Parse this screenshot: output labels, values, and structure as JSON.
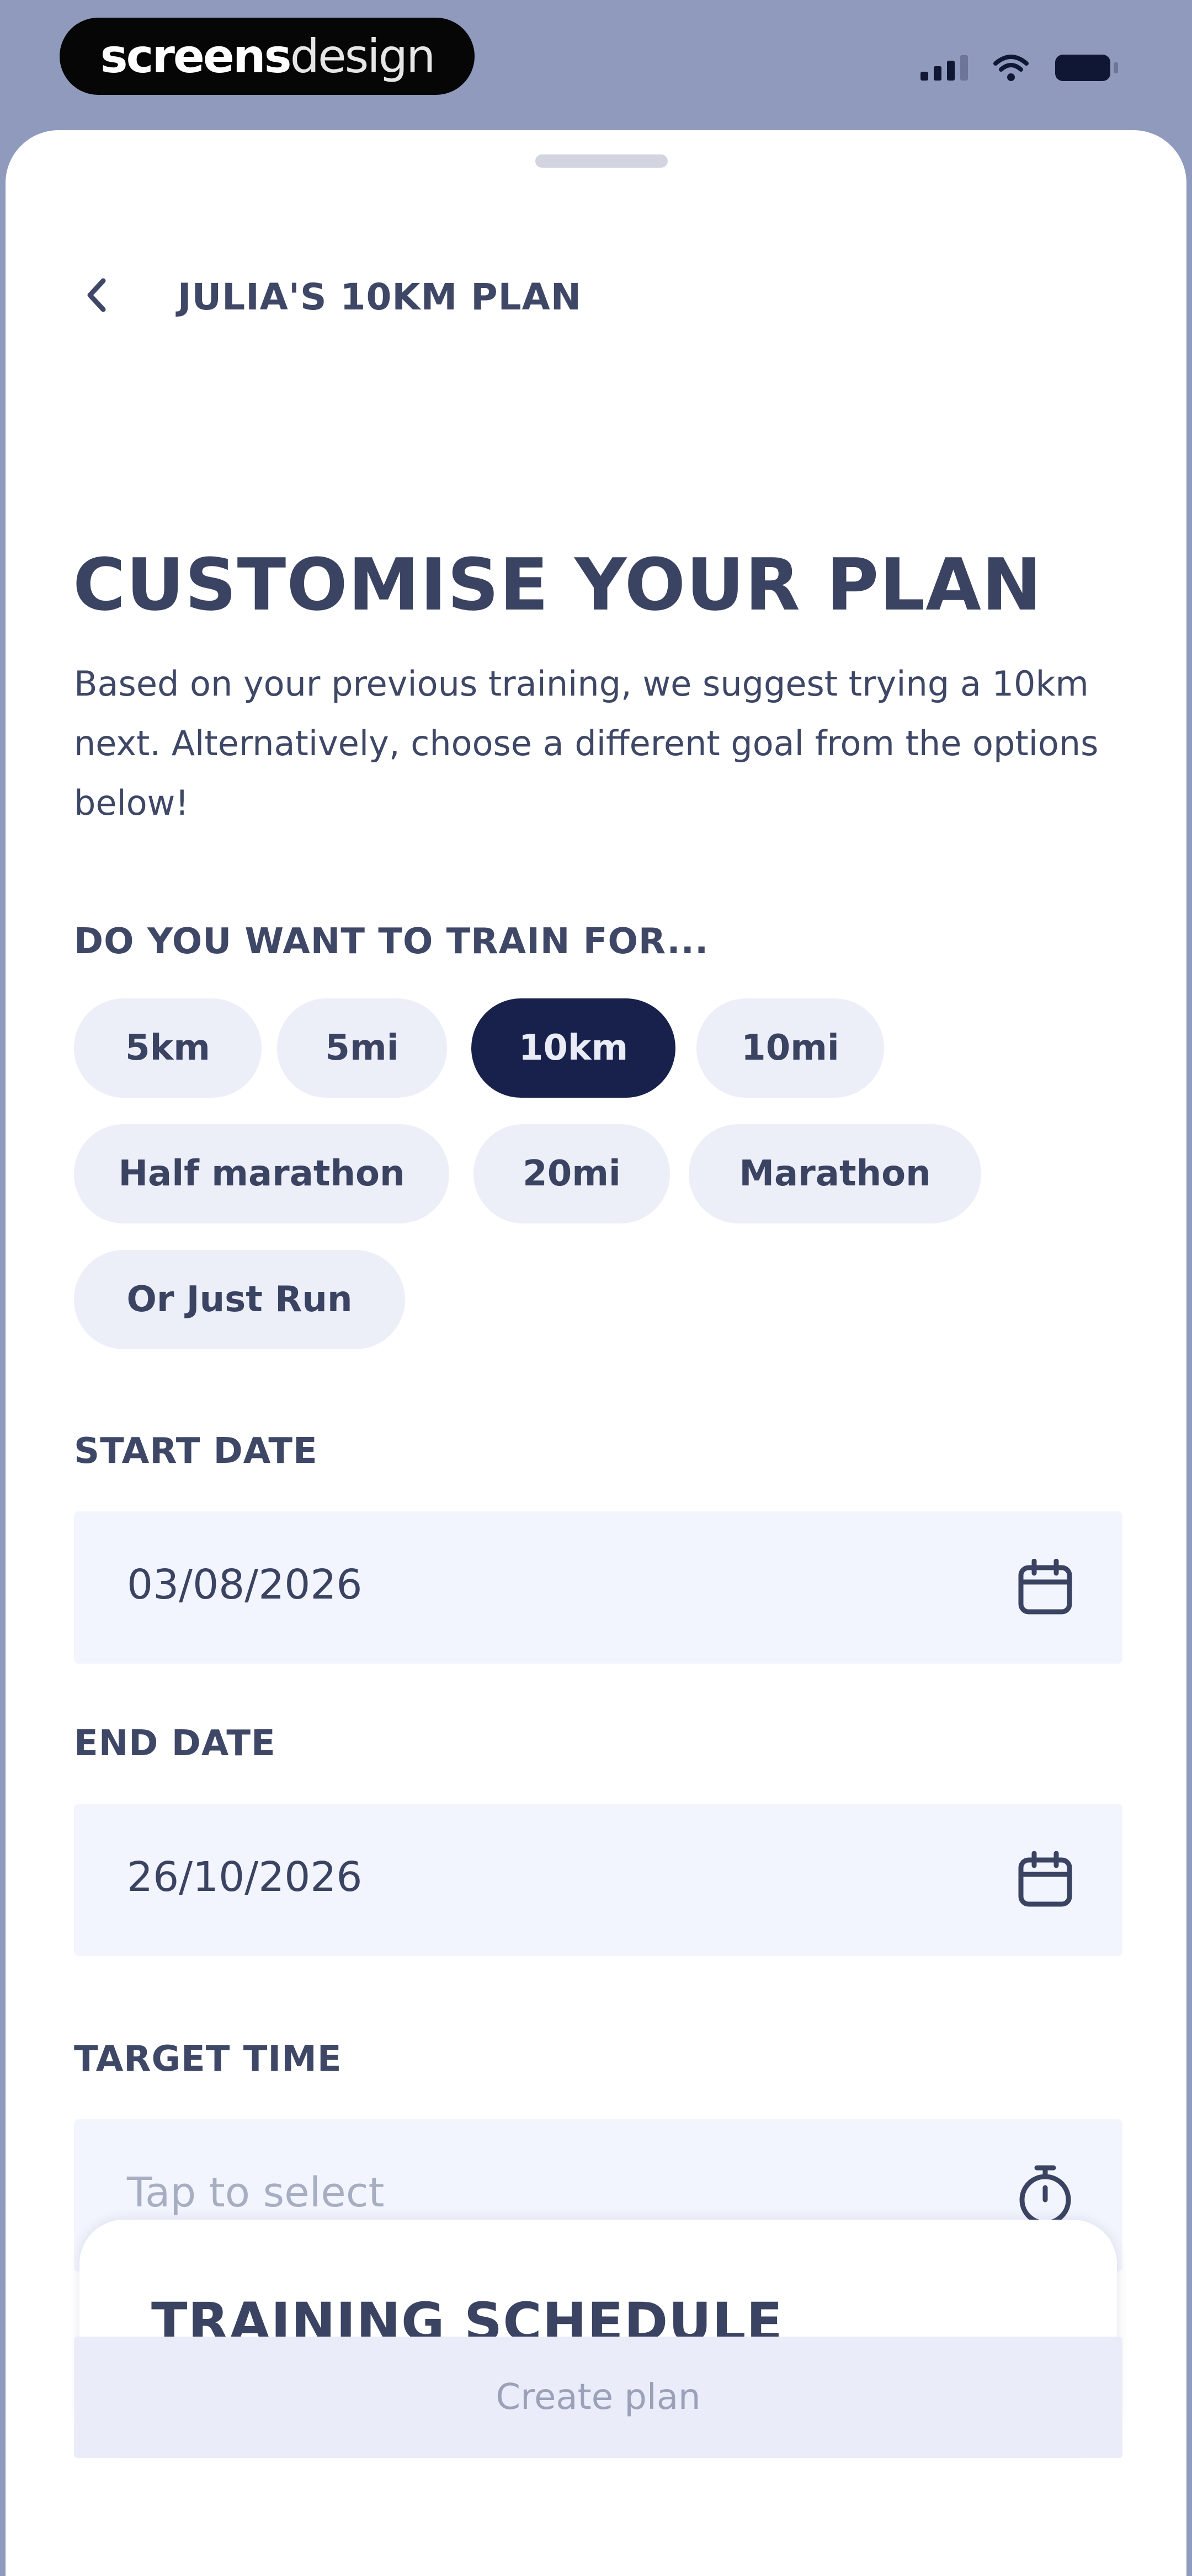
{
  "status_bar": {
    "brand_bold": "screens",
    "brand_light": "design"
  },
  "nav": {
    "title": "JULIA'S 10KM PLAN"
  },
  "page": {
    "title": "CUSTOMISE YOUR PLAN",
    "description": "Based on your previous training, we suggest trying a 10km next. Alternatively, choose a different goal from the options below!"
  },
  "goal": {
    "label": "DO YOU WANT TO TRAIN FOR...",
    "options": [
      "5km",
      "5mi",
      "10km",
      "10mi",
      "Half marathon",
      "20mi",
      "Marathon",
      "Or Just Run"
    ],
    "selected": "10km"
  },
  "start_date": {
    "label": "START DATE",
    "value": "03/08/2026"
  },
  "end_date": {
    "label": "END DATE",
    "value": "26/10/2026"
  },
  "target_time": {
    "label": "TARGET TIME",
    "placeholder": "Tap to select"
  },
  "schedule": {
    "title": "TRAINING SCHEDULE"
  },
  "actions": {
    "create_label": "Create plan"
  },
  "colors": {
    "accent": "#17214b",
    "chip_background": "#eceef8",
    "field_background": "#f2f5fd",
    "status_bar_background": "#8f9abd"
  }
}
